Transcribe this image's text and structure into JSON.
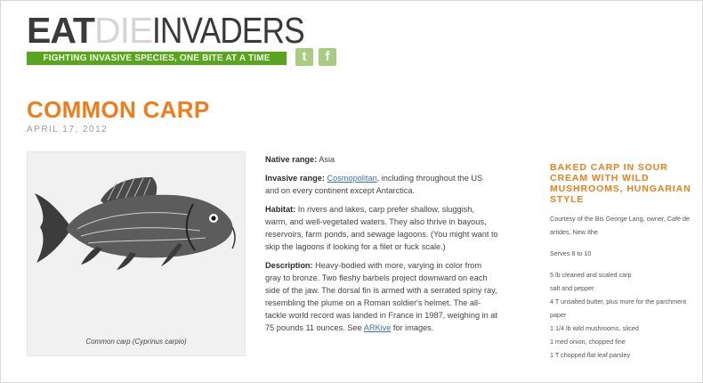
{
  "logo": {
    "part_eat": "EAT",
    "part_die": "DIE",
    "part_invaders": "INVADERS"
  },
  "tagline": "FIGHTING INVASIVE SPECIES, ONE BITE AT A TIME",
  "social": {
    "twitter_glyph": "t",
    "facebook_glyph": "f"
  },
  "article": {
    "title": "COMMON CARP",
    "date": "APRIL 17, 2012",
    "image_caption": "Common carp (Cyprinus carpio)",
    "native_label": "Native range:",
    "native_value": " Asia",
    "invasive_label": "Invasive range:",
    "invasive_link": "Cosmopolitan",
    "invasive_rest": ", including throughout the US and on every continent except Antarctica.",
    "habitat_label": "Habitat:",
    "habitat_text": " In rivers and lakes, carp prefer shallow, sluggish, warm, and well-vegetated waters. They also thrive in bayous, reservoirs, farm ponds, and sewage lagoons. (You might want to skip the lagoons if looking for a filet or fuck scale.)",
    "desc_label": "Description:",
    "desc_text": " Heavy-bodied with more, varying in color from gray to bronze. Two fleshy barbels project downward on each side of the jaw. The dorsal fin is armed with a serrated spiny ray, resembling the plume on a Roman soldier's helmet. The all-tackle world record was landed in France in 1987, weighing in at 75 pounds 11 ounces. See ",
    "desc_link": "ARKive",
    "desc_end": " for images."
  },
  "recipe": {
    "title_lines": [
      "BAKED CARP IN SOUR",
      "CREAM WITH WILD",
      "MUSHROOMS, HUNGARIAN",
      "STYLE"
    ],
    "courtesy_1": "Courtesy of the Bis George Lang, owner, Cafe de",
    "courtesy_2": "artides, New Ithe",
    "serves": "Serves 8 to 10",
    "ingredients": [
      "5 lb cleaned and scaled carp",
      "salt and pepper",
      "4 T unsalted butter, plus more for the parchment",
      "paper",
      "1 1/4 lb wild mushrooms, sliced",
      "1 med onion, chopped fine",
      "1 T chopped flat leaf parsley"
    ]
  }
}
